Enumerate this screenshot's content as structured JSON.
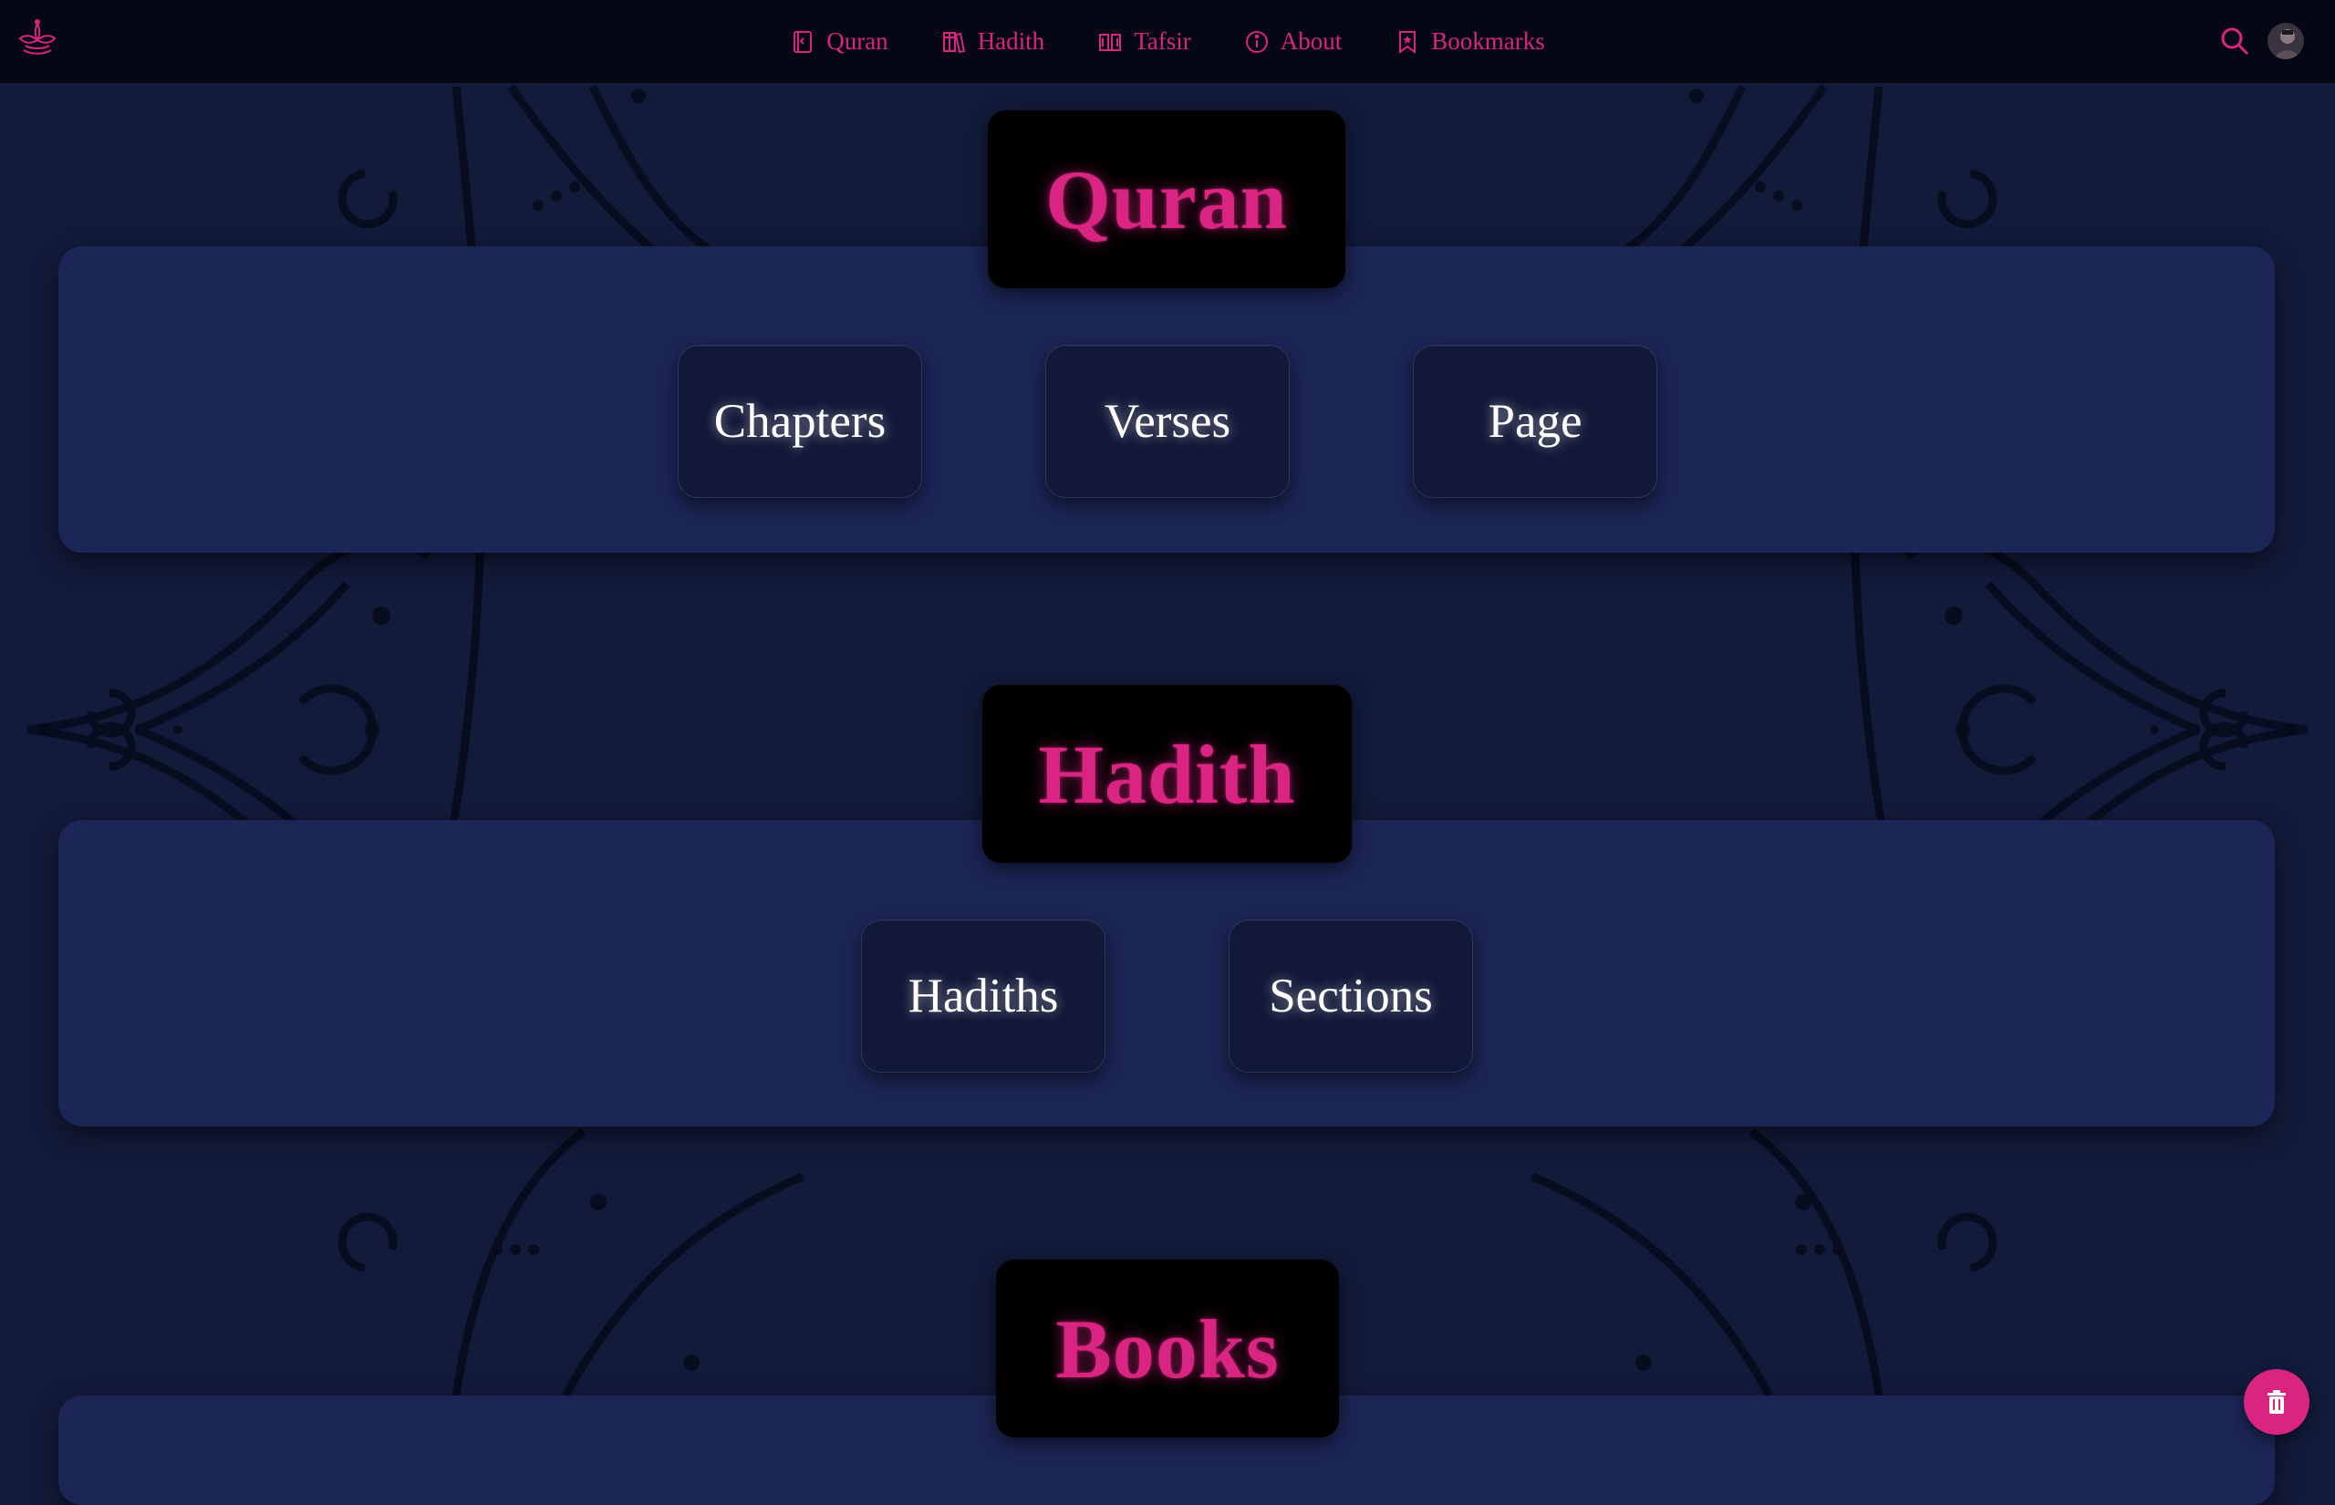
{
  "nav": {
    "logo_icon": "lotus-icon",
    "items": [
      {
        "label": "Quran",
        "icon": "book-icon"
      },
      {
        "label": "Hadith",
        "icon": "books-icon"
      },
      {
        "label": "Tafsir",
        "icon": "open-book-icon"
      },
      {
        "label": "About",
        "icon": "info-icon"
      },
      {
        "label": "Bookmarks",
        "icon": "bookmark-icon"
      }
    ],
    "search_icon": "search-icon",
    "avatar": "user-avatar"
  },
  "sections": {
    "quran": {
      "title": "Quran",
      "buttons": [
        "Chapters",
        "Verses",
        "Page"
      ]
    },
    "hadith": {
      "title": "Hadith",
      "buttons": [
        "Hadiths",
        "Sections"
      ]
    },
    "books": {
      "title": "Books"
    }
  },
  "fab": {
    "icon": "trash-icon"
  },
  "colors": {
    "accent": "#d92581",
    "background": "#131b3b",
    "panel": "#1c2656",
    "navbar": "#050814",
    "badge": "#000000",
    "button": "#121938"
  }
}
